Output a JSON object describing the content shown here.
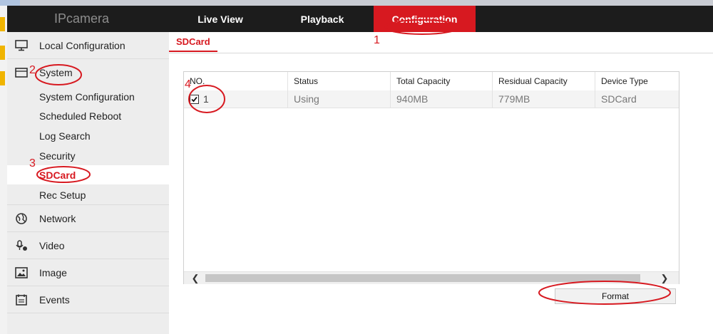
{
  "app": {
    "title": "IPcamera"
  },
  "nav": [
    {
      "label": "Live View"
    },
    {
      "label": "Playback"
    },
    {
      "label": "Configuration"
    }
  ],
  "sidebar": {
    "sections": [
      {
        "label": "Local Configuration",
        "icon": "monitor-icon"
      },
      {
        "label": "System",
        "icon": "window-icon"
      },
      {
        "label": "Network",
        "icon": "globe-icon"
      },
      {
        "label": "Video",
        "icon": "microphone-icon"
      },
      {
        "label": "Image",
        "icon": "picture-icon"
      },
      {
        "label": "Events",
        "icon": "calendar-icon"
      }
    ],
    "system_items": [
      {
        "label": "System Configuration"
      },
      {
        "label": "Scheduled Reboot"
      },
      {
        "label": "Log Search"
      },
      {
        "label": "Security"
      },
      {
        "label": "SDCard"
      },
      {
        "label": "Rec Setup"
      }
    ]
  },
  "main": {
    "tab": "SDCard",
    "table": {
      "headers": [
        "NO.",
        "Status",
        "Total Capacity",
        "Residual Capacity",
        "Device Type"
      ],
      "rows": [
        {
          "checked": true,
          "no": "1",
          "status": "Using",
          "total": "940MB",
          "residual": "779MB",
          "type": "SDCard"
        }
      ]
    },
    "format_label": "Format"
  },
  "annotations": [
    "1",
    "2",
    "3",
    "4"
  ],
  "colors": {
    "accent": "#d71920",
    "header_bg": "#1c1c1c",
    "sidebar_bg": "#ededed"
  }
}
